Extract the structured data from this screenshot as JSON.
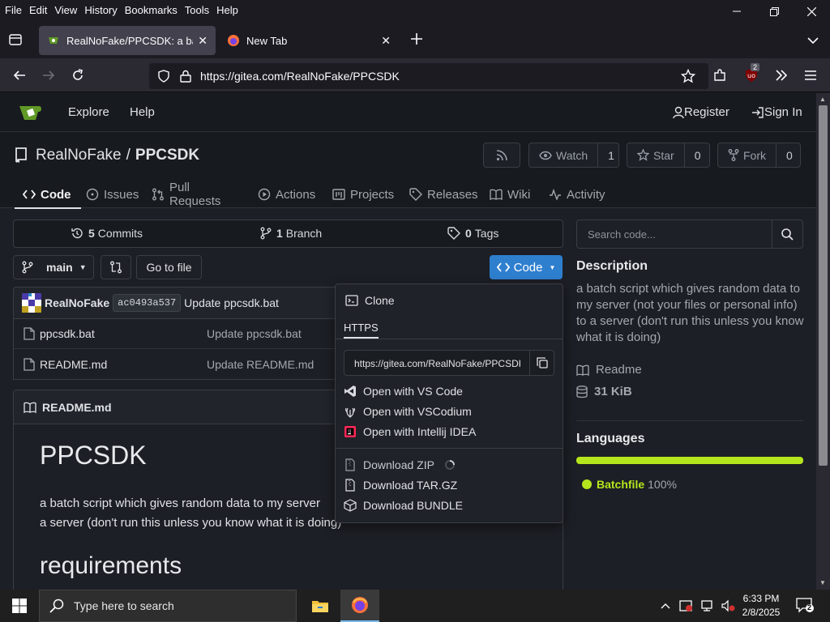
{
  "menubar": {
    "items": [
      {
        "label": "File"
      },
      {
        "label": "Edit"
      },
      {
        "label": "View"
      },
      {
        "label": "History"
      },
      {
        "label": "Bookmarks"
      },
      {
        "label": "Tools"
      },
      {
        "label": "Help"
      }
    ]
  },
  "browser": {
    "tabs": [
      {
        "title": "RealNoFake/PPCSDK: a batch sc",
        "active": true
      },
      {
        "title": "New Tab",
        "active": false
      }
    ],
    "url": "https://gitea.com/RealNoFake/PPCSDK",
    "extension_badge": "2"
  },
  "gitea": {
    "nav": {
      "explore": "Explore",
      "help": "Help",
      "register": "Register",
      "signin": "Sign In"
    },
    "repo": {
      "owner": "RealNoFake",
      "separator": "/",
      "name": "PPCSDK"
    },
    "watch": {
      "label": "Watch",
      "count": "1"
    },
    "star": {
      "label": "Star",
      "count": "0"
    },
    "fork": {
      "label": "Fork",
      "count": "0"
    },
    "tabs": [
      {
        "label": "Code",
        "icon": "code-icon",
        "active": true
      },
      {
        "label": "Issues",
        "icon": "issue-icon",
        "active": false
      },
      {
        "label": "Pull Requests",
        "icon": "pull-request-icon",
        "active": false
      },
      {
        "label": "Actions",
        "icon": "play-icon",
        "active": false
      },
      {
        "label": "Projects",
        "icon": "project-icon",
        "active": false
      },
      {
        "label": "Releases",
        "icon": "tag-icon",
        "active": false
      },
      {
        "label": "Wiki",
        "icon": "book-icon",
        "active": false
      },
      {
        "label": "Activity",
        "icon": "pulse-icon",
        "active": false
      }
    ],
    "stats": {
      "commits_count": "5",
      "commits_label": "Commits",
      "branch_count": "1",
      "branch_label": "Branch",
      "tags_count": "0",
      "tags_label": "Tags"
    },
    "branch_select": "main",
    "go_to_file": "Go to file",
    "code_button": "Code",
    "latest_commit": {
      "author": "RealNoFake",
      "sha": "ac0493a537",
      "message": "Update ppcsdk.bat"
    },
    "files": [
      {
        "name": "ppcsdk.bat",
        "message": "Update ppcsdk.bat"
      },
      {
        "name": "README.md",
        "message": "Update README.md"
      }
    ],
    "readme": {
      "filename": "README.md",
      "heading": "PPCSDK",
      "paragraph_line1": "a batch script which gives random data to my server",
      "paragraph_line2": "a server (don't run this unless you know what it is doing)",
      "subheading": "requirements"
    },
    "sidebar": {
      "search_placeholder": "Search code...",
      "description_title": "Description",
      "description": "a batch script which gives random data to my server (not your files or personal info) to a server (don't run this unless you know what it is doing)",
      "readme_label": "Readme",
      "size": "31 KiB",
      "languages_title": "Languages",
      "language_name": "Batchfile",
      "language_percent": "100%",
      "language_color": "#b5e61d"
    },
    "clone_dropdown": {
      "title": "Clone",
      "protocol": "HTTPS",
      "clone_url": "https://gitea.com/RealNoFake/PPCSDK.git",
      "open_items": [
        "Open with VS Code",
        "Open with VSCodium",
        "Open with Intellij IDEA"
      ],
      "download_items": [
        "Download ZIP",
        "Download TAR.GZ",
        "Download BUNDLE"
      ]
    }
  },
  "taskbar": {
    "search_placeholder": "Type here to search",
    "time": "6:33 PM",
    "date": "2/8/2025",
    "notification_count": "2"
  },
  "colors": {
    "accent_blue": "#2f7fcf",
    "gitea_green": "#609926"
  }
}
